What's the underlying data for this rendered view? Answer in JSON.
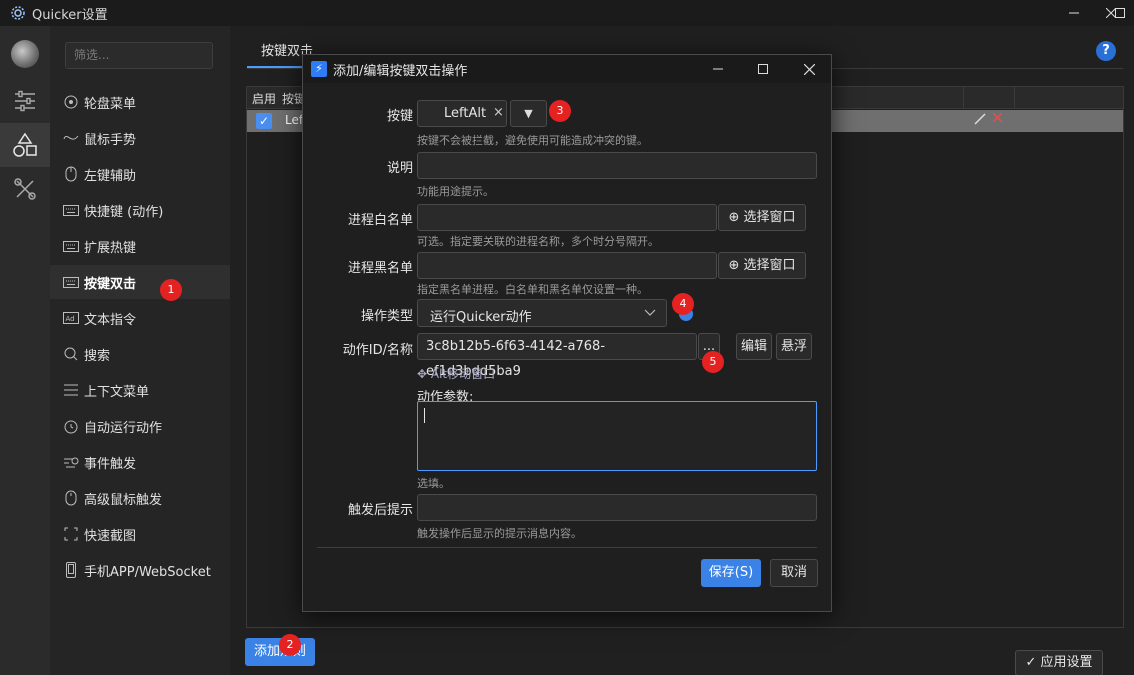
{
  "app": {
    "title": "Quicker设置"
  },
  "sidebar": {
    "filter_placeholder": "筛选...",
    "items": [
      {
        "label": "轮盘菜单",
        "icon": "circle-dot-icon"
      },
      {
        "label": "鼠标手势",
        "icon": "gesture-icon"
      },
      {
        "label": "左键辅助",
        "icon": "mouse-icon"
      },
      {
        "label": "快捷键 (动作)",
        "icon": "keyboard-icon"
      },
      {
        "label": "扩展热键",
        "icon": "keyboard-icon"
      },
      {
        "label": "按键双击",
        "icon": "keyboard-icon",
        "active": true
      },
      {
        "label": "文本指令",
        "icon": "ad-text-icon"
      },
      {
        "label": "搜索",
        "icon": "search-icon"
      },
      {
        "label": "上下文菜单",
        "icon": "menu-icon"
      },
      {
        "label": "自动运行动作",
        "icon": "alarm-icon"
      },
      {
        "label": "事件触发",
        "icon": "event-icon"
      },
      {
        "label": "高级鼠标触发",
        "icon": "mouse-icon"
      },
      {
        "label": "快速截图",
        "icon": "screenshot-icon"
      },
      {
        "label": "手机APP/WebSocket",
        "icon": "phone-icon"
      }
    ]
  },
  "main": {
    "tab_label": "按键双击",
    "grid": {
      "headers": [
        "启用",
        "按键"
      ],
      "rows": [
        {
          "enabled": true,
          "key": "Lef"
        }
      ]
    },
    "add_button": "添加规则",
    "apply_button": "应用设置",
    "help": "?"
  },
  "dialog": {
    "title": "添加/编辑按键双击操作",
    "key": {
      "label": "按键",
      "value": "LeftAlt",
      "clear": "×",
      "dropdown": "▼",
      "hint": "按键不会被拦截，避免使用可能造成冲突的键。"
    },
    "desc": {
      "label": "说明",
      "value": "",
      "hint": "功能用途提示。"
    },
    "whitelist": {
      "label": "进程白名单",
      "value": "",
      "button": "选择窗口",
      "hint": "可选。指定要关联的进程名称，多个时分号隔开。"
    },
    "blacklist": {
      "label": "进程黑名单",
      "value": "",
      "button": "选择窗口",
      "hint": "指定黑名单进程。白名单和黑名单仅设置一种。"
    },
    "op_type": {
      "label": "操作类型",
      "value": "运行Quicker动作"
    },
    "action": {
      "label": "动作ID/名称",
      "value": "3c8b12b5-6f63-4142-a768-ef1d3bdd5ba9",
      "more": "...",
      "edit": "编辑",
      "float": "悬浮"
    },
    "alt_move": "Alt移动窗口",
    "params": {
      "label": "动作参数:",
      "hint": "选填。"
    },
    "after_tip": {
      "label": "触发后提示",
      "value": "",
      "hint": "触发操作后显示的提示消息内容。"
    },
    "save": "保存(S)",
    "cancel": "取消"
  },
  "markers": [
    "1",
    "2",
    "3",
    "4",
    "5"
  ],
  "colors": {
    "accent": "#3b82e6",
    "marker": "#e52222",
    "focus": "#4c9bff"
  }
}
